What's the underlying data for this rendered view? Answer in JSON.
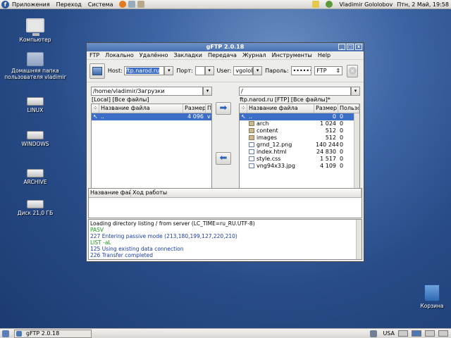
{
  "topbar": {
    "menus": [
      "Приложения",
      "Переход",
      "Система"
    ],
    "user": "Vladimir Gololobov",
    "datetime": "Птн, 2 Май, 19:58"
  },
  "desktop": {
    "icons": [
      {
        "label": "Компьютер"
      },
      {
        "label": "Домашняя папка пользователя vladimir"
      },
      {
        "label": "LINUX"
      },
      {
        "label": "WINDOWS"
      },
      {
        "label": "ARCHIVE"
      },
      {
        "label": "Диск 21,0 ГБ"
      },
      {
        "label": "Корзина"
      }
    ]
  },
  "window": {
    "title": "gFTP 2.0.18",
    "menu": [
      "FTP",
      "Локально",
      "Удалённо",
      "Закладки",
      "Передача",
      "Журнал",
      "Инструменты",
      "Help"
    ],
    "connection": {
      "host_label": "Host:",
      "host_value": "ftp.narod.ru",
      "port_label": "Порт:",
      "port_value": "",
      "user_label": "User:",
      "user_value": "vgolol",
      "password_label": "Пароль:",
      "password_value": "••••••",
      "protocol": "FTP"
    },
    "local": {
      "path": "/home/vladimir/Загрузки",
      "status": "[Local] [Все файлы]",
      "columns": [
        "Название файла",
        "Размер",
        "П"
      ],
      "rows": [
        {
          "name": "..",
          "size": "4 096",
          "extra": "v"
        }
      ]
    },
    "remote": {
      "path": "/",
      "status": "ftp.narod.ru [FTP] [Все файлы]*",
      "columns": [
        "Название файла",
        "Размер",
        "Пользов"
      ],
      "rows": [
        {
          "name": "..",
          "size": "0",
          "user": "0",
          "type": "up"
        },
        {
          "name": "arch",
          "size": "1 024",
          "user": "0",
          "type": "folder"
        },
        {
          "name": "content",
          "size": "512",
          "user": "0",
          "type": "folder"
        },
        {
          "name": "images",
          "size": "512",
          "user": "0",
          "type": "folder"
        },
        {
          "name": "grnd_12.png",
          "size": "140 244",
          "user": "0",
          "type": "image"
        },
        {
          "name": "index.html",
          "size": "24 830",
          "user": "0",
          "type": "doc"
        },
        {
          "name": "style.css",
          "size": "1 517",
          "user": "0",
          "type": "doc"
        },
        {
          "name": "vng94x33.jpg",
          "size": "4 109",
          "user": "0",
          "type": "image"
        }
      ]
    },
    "transfer_columns": [
      "Название файл",
      "Ход работы"
    ],
    "log": [
      {
        "text": "Loading directory listing / from server (LC_TIME=ru_RU.UTF-8)",
        "kind": "info"
      },
      {
        "text": "PASV",
        "kind": "cmd"
      },
      {
        "text": "227 Entering passive mode (213,180,199,127,220,210)",
        "kind": "resp"
      },
      {
        "text": "LIST -aL",
        "kind": "cmd"
      },
      {
        "text": "125 Using existing data connection",
        "kind": "resp"
      },
      {
        "text": "226 Transfer completed",
        "kind": "resp"
      }
    ]
  },
  "taskbar": {
    "item": "gFTP 2.0.18",
    "keyboard": "USA"
  },
  "colors": {
    "selection": "#3d6ec7",
    "log_cmd": "#1a9a1a",
    "log_resp": "#1a3aa8",
    "titlebar": "#4670b3"
  }
}
